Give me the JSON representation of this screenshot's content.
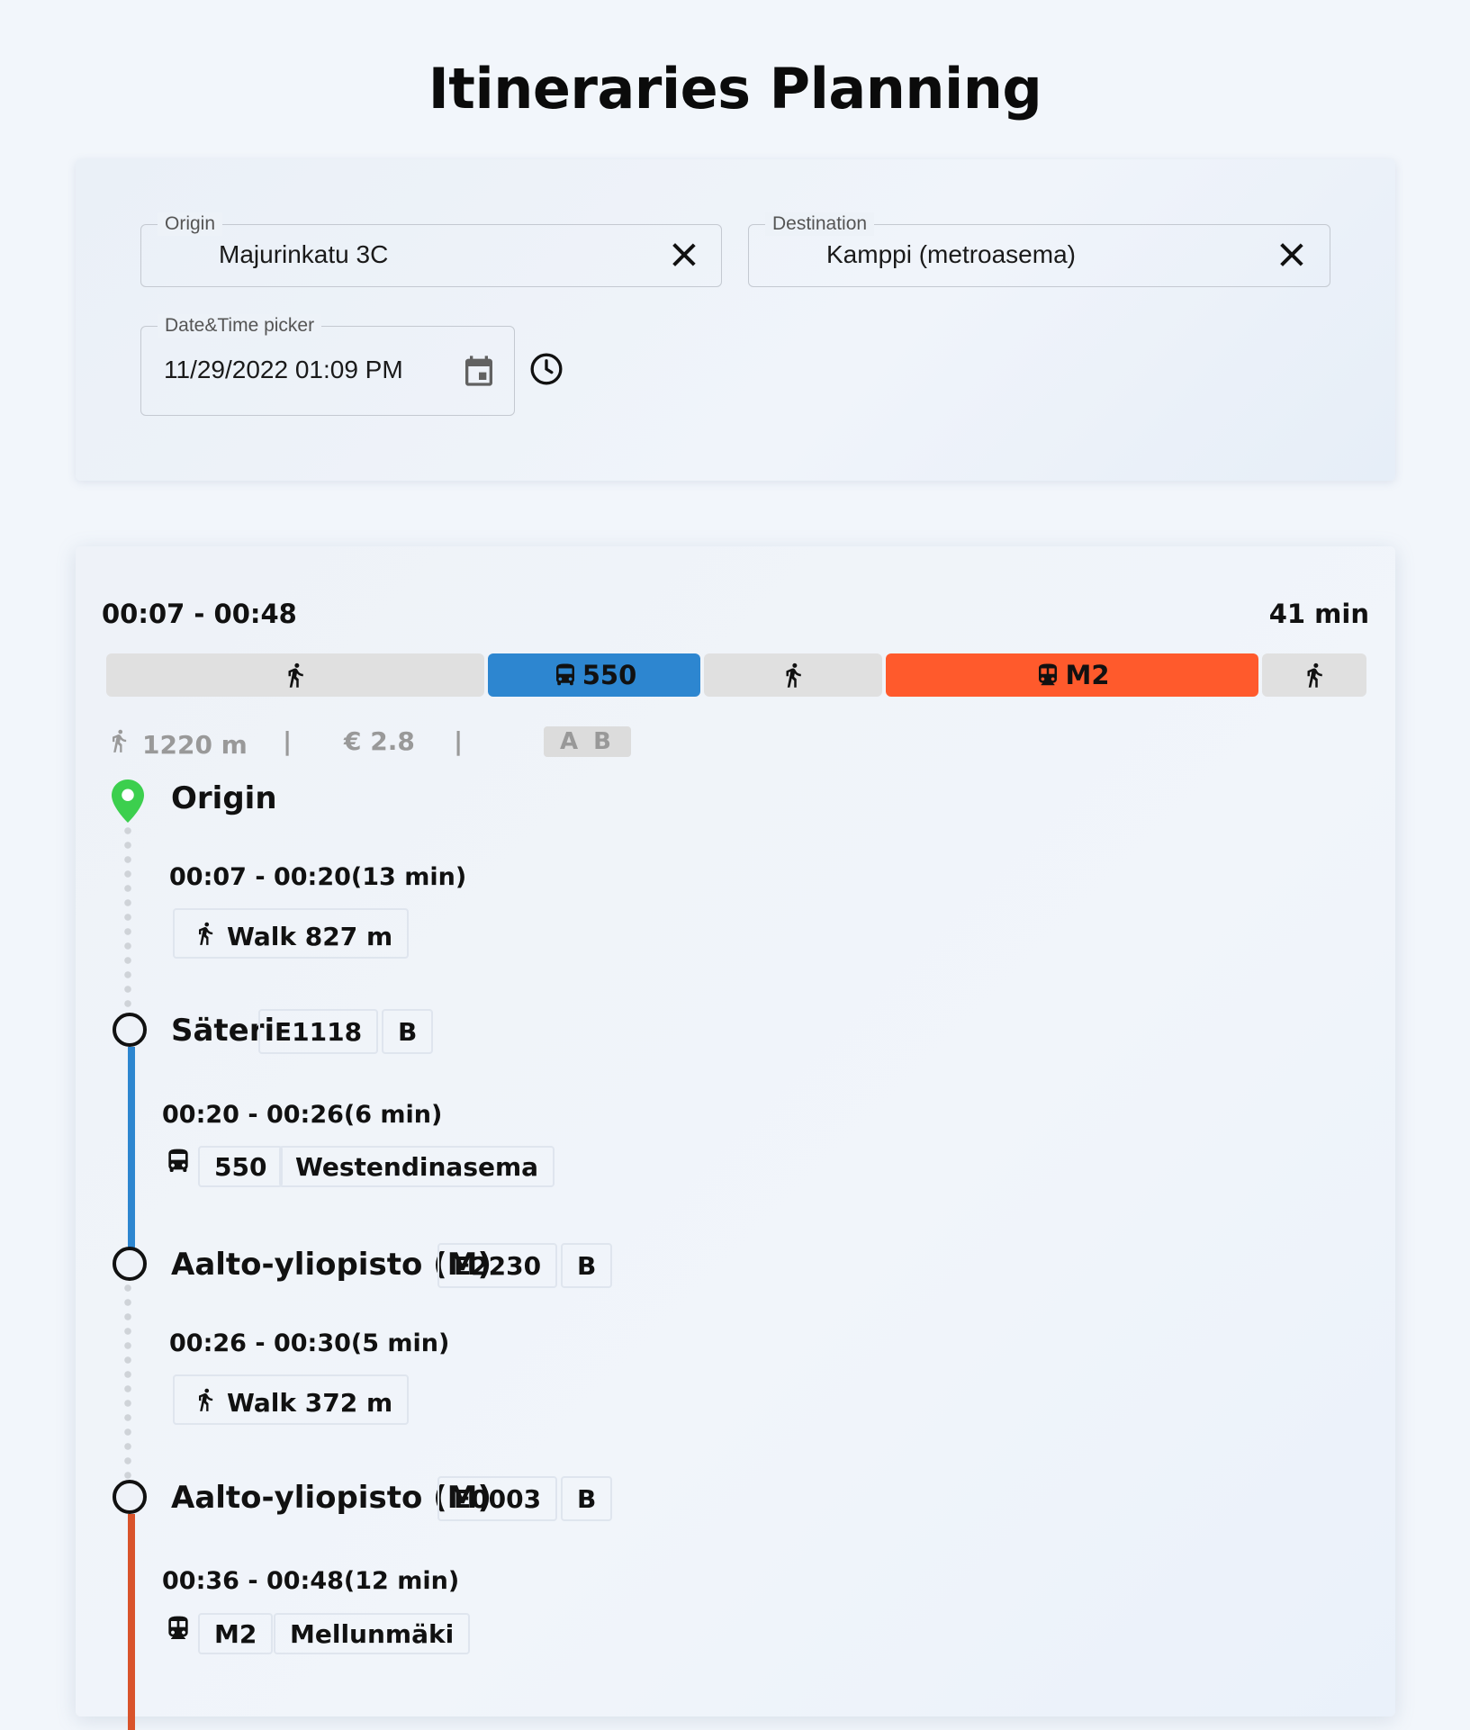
{
  "page": {
    "title": "Itineraries Planning"
  },
  "search": {
    "origin": {
      "label": "Origin",
      "value": "Majurinkatu 3C"
    },
    "destination": {
      "label": "Destination",
      "value": "Kamppi (metroasema)"
    },
    "datetime": {
      "label": "Date&Time picker",
      "value": "11/29/2022 01:09 PM"
    }
  },
  "itinerary": {
    "time_range": "00:07 - 00:48",
    "duration": "41 min",
    "mode_bar": [
      {
        "mode": "walk",
        "label": "",
        "color": "#e0e0e0",
        "share": 0.302
      },
      {
        "mode": "bus",
        "label": "550",
        "color": "#2d86d0",
        "share": 0.17
      },
      {
        "mode": "walk",
        "label": "",
        "color": "#e0e0e0",
        "share": 0.144
      },
      {
        "mode": "metro",
        "label": "M2",
        "color": "#ff5a2c",
        "share": 0.298
      },
      {
        "mode": "walk",
        "label": "",
        "color": "#e0e0e0",
        "share": 0.084
      }
    ],
    "summary": {
      "walk_distance": "1220 m",
      "separator": "|",
      "fare": "€ 2.8",
      "zones": "A B"
    },
    "origin_label": "Origin",
    "legs": [
      {
        "time": "00:07 - 00:20(13 min)",
        "type": "walk",
        "desc": "Walk 827 m"
      },
      {
        "stop": "Säteri",
        "code": "E1118",
        "zone": "B",
        "time": "00:20 - 00:26(6 min)",
        "type": "bus",
        "route": "550",
        "headsign": "Westendinasema",
        "color": "#2d86d0"
      },
      {
        "stop": "Aalto-yliopisto (M)",
        "code": "E2230",
        "zone": "B",
        "time": "00:26 - 00:30(5 min)",
        "type": "walk",
        "desc": "Walk 372 m"
      },
      {
        "stop": "Aalto-yliopisto (M)",
        "code": "E0003",
        "zone": "B",
        "time": "00:36 - 00:48(12 min)",
        "type": "metro",
        "route": "M2",
        "headsign": "Mellunmäki",
        "color": "#d9532b"
      }
    ]
  },
  "colors": {
    "origin_pin": "#3ccf4e",
    "walk_bar": "#e0e0e0",
    "bus": "#2d86d0",
    "metro": "#ff5a2c",
    "metro_line": "#d9532b"
  }
}
